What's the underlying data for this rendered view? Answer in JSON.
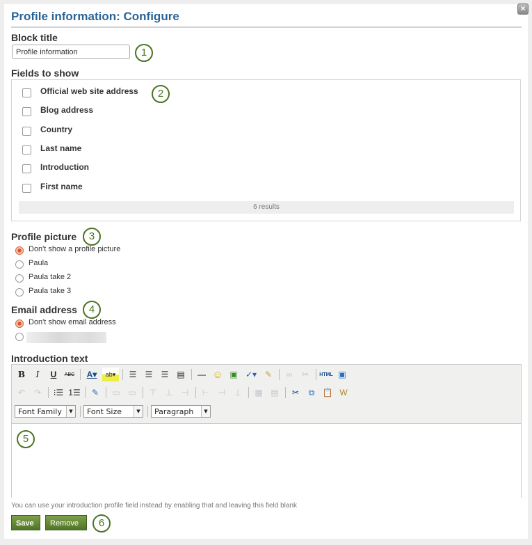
{
  "dialog": {
    "title": "Profile information: Configure",
    "close_icon": "close-icon"
  },
  "block_title": {
    "label": "Block title",
    "value": "Profile information",
    "callout": "1"
  },
  "fields_to_show": {
    "label": "Fields to show",
    "callout": "2",
    "items": [
      {
        "label": "Official web site address",
        "checked": false
      },
      {
        "label": "Blog address",
        "checked": false
      },
      {
        "label": "Country",
        "checked": false
      },
      {
        "label": "Last name",
        "checked": false
      },
      {
        "label": "Introduction",
        "checked": false
      },
      {
        "label": "First name",
        "checked": false
      }
    ],
    "results": "6 results"
  },
  "profile_picture": {
    "label": "Profile picture",
    "callout": "3",
    "options": [
      {
        "label": "Don't show a profile picture",
        "checked": true
      },
      {
        "label": "Paula",
        "checked": false
      },
      {
        "label": "Paula take 2",
        "checked": false
      },
      {
        "label": "Paula take 3",
        "checked": false
      }
    ]
  },
  "email_address": {
    "label": "Email address",
    "callout": "4",
    "options": [
      {
        "label": "Don't show email address",
        "checked": true
      },
      {
        "label": "",
        "checked": false,
        "blurred": true
      }
    ]
  },
  "introduction_text": {
    "label": "Introduction text",
    "callout": "5",
    "toolbar_row1": [
      "bold-icon",
      "italic-icon",
      "underline-icon",
      "strikethrough-icon",
      "|",
      "text-color-icon",
      "highlight-color-icon",
      "|",
      "align-left-icon",
      "align-center-icon",
      "align-right-icon",
      "align-justify-icon",
      "|",
      "horizontal-rule-icon",
      "emoticon-icon",
      "image-icon",
      "spellcheck-icon",
      "cleanup-icon",
      "|",
      "link-icon",
      "unlink-icon",
      "|",
      "html-source-icon",
      "fullscreen-icon"
    ],
    "toolbar_row2": [
      "undo-icon",
      "redo-icon",
      "|",
      "bullet-list-icon",
      "numbered-list-icon",
      "|",
      "edit-icon",
      "|",
      "table-row-icon",
      "table-cell-icon",
      "|",
      "insert-row-before-icon",
      "insert-row-after-icon",
      "delete-row-icon",
      "|",
      "insert-col-before-icon",
      "insert-col-after-icon",
      "delete-col-icon",
      "|",
      "table-icon",
      "table-props-icon",
      "|",
      "cut-icon",
      "copy-icon",
      "paste-icon",
      "paste-word-icon"
    ],
    "font_family": "Font Family",
    "font_size": "Font Size",
    "format": "Paragraph",
    "hint": "You can use your introduction profile field instead by enabling that and leaving this field blank"
  },
  "actions": {
    "save": "Save",
    "remove": "Remove",
    "callout": "6"
  }
}
